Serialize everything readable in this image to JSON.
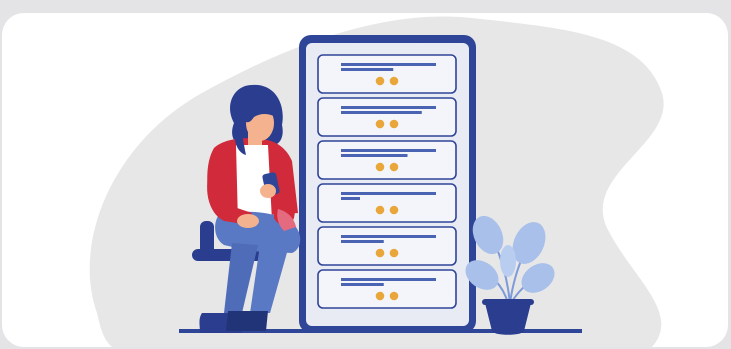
{
  "illustration": {
    "subject": "woman-seated-on-stool-using-phone-beside-large-phone",
    "colors": {
      "page_background": "#e4e4e6",
      "card_background": "#ffffff",
      "blob": "#e7e7e8",
      "phone_frame": "#2f4597",
      "phone_screen": "#e8ebf4",
      "list_card_fill": "#f4f5fa",
      "text_bar": "#4a63b3",
      "accent_dot": "#e9a63a",
      "jacket": "#d12a3a",
      "shirt": "#ffffff",
      "jeans": "#5a79c4",
      "hair": "#2a3d8f",
      "skin": "#f5b28f",
      "plant_leaf": "#a9c0ea",
      "pot": "#2a3d8f",
      "floor_line": "#2f4597"
    },
    "list_cards": [
      {
        "bars": [
          1.0,
          0.55
        ]
      },
      {
        "bars": [
          1.0,
          0.85
        ]
      },
      {
        "bars": [
          1.0,
          0.7
        ]
      },
      {
        "bars": [
          1.0,
          0.2
        ]
      },
      {
        "bars": [
          1.0,
          0.45
        ]
      },
      {
        "bars": [
          1.0,
          0.45
        ]
      }
    ]
  }
}
